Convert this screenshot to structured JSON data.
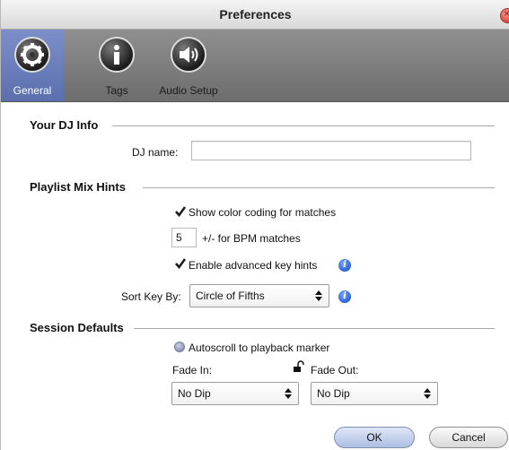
{
  "window": {
    "title": "Preferences"
  },
  "tabs": [
    {
      "label": "General",
      "icon": "gear-icon",
      "active": true
    },
    {
      "label": "Tags",
      "icon": "info-icon",
      "active": false
    },
    {
      "label": "Audio Setup",
      "icon": "speaker-icon",
      "active": false
    }
  ],
  "dj_info": {
    "title": "Your DJ Info",
    "name_label": "DJ name:",
    "name_value": ""
  },
  "playlist": {
    "title": "Playlist Mix Hints",
    "color_coding_label": "Show color coding for matches",
    "color_coding_checked": true,
    "bpm_value": "5",
    "bpm_label": "+/- for BPM matches",
    "key_hints_label": "Enable advanced key hints",
    "key_hints_checked": true,
    "sort_label": "Sort Key By:",
    "sort_value": "Circle of Fifths"
  },
  "session": {
    "title": "Session Defaults",
    "autoscroll_label": "Autoscroll to playback marker",
    "fade_in_label": "Fade In:",
    "fade_out_label": "Fade Out:",
    "fade_in_value": "No Dip",
    "fade_out_value": "No Dip"
  },
  "buttons": {
    "ok": "OK",
    "cancel": "Cancel"
  },
  "colors": {
    "active_tab": "#6a7ec0",
    "toolbar": "#7d7d7d",
    "info": "#2a5fd8"
  }
}
